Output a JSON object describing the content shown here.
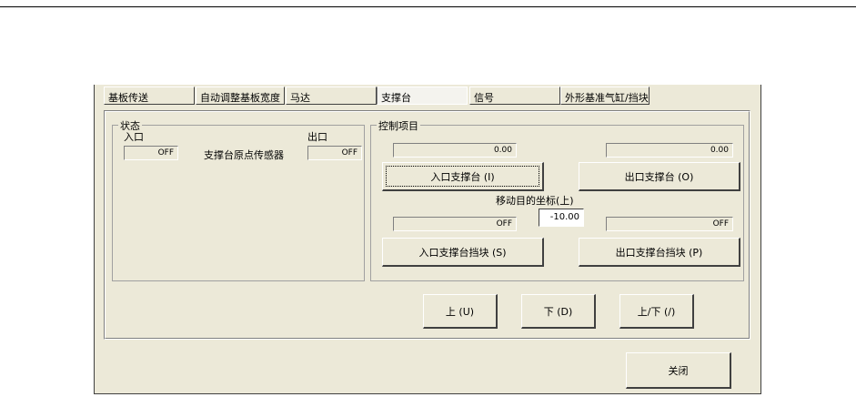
{
  "tabs": [
    {
      "label": "基板传送"
    },
    {
      "label": "自动调整基板宽度"
    },
    {
      "label": "马达"
    },
    {
      "label": "支撑台"
    },
    {
      "label": "信号"
    },
    {
      "label": "外形基准气缸/挡块"
    }
  ],
  "active_tab": "支撑台",
  "status": {
    "title": "状态",
    "entrance_label": "入口",
    "exit_label": "出口",
    "entrance_value": "OFF",
    "exit_value": "OFF",
    "sensor_label": "支撑台原点传感器"
  },
  "control": {
    "title": "控制项目",
    "entrance_position": "0.00",
    "exit_position": "0.00",
    "entrance_support_button": "入口支撑台 (I)",
    "exit_support_button": "出口支撑台 (O)",
    "target_label": "移动目的坐标(上)",
    "target_value": "-10.00",
    "entrance_stopper_status": "OFF",
    "exit_stopper_status": "OFF",
    "entrance_stopper_button": "入口支撑台挡块 (S)",
    "exit_stopper_button": "出口支撑台挡块 (P)"
  },
  "motion": {
    "up_button": "上 (U)",
    "down_button": "下 (D)",
    "updown_button": "上/下 (/)"
  },
  "close_button": "关闭"
}
